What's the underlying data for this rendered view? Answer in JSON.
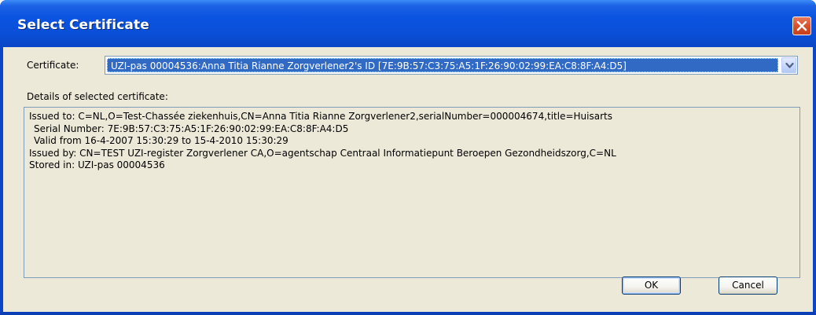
{
  "window": {
    "title": "Select Certificate"
  },
  "certificate": {
    "label": "Certificate:",
    "selected": "UZI-pas 00004536:Anna Titia Rianne Zorgverlener2's ID [7E:9B:57:C3:75:A5:1F:26:90:02:99:EA:C8:8F:A4:D5]"
  },
  "details": {
    "label": "Details of selected certificate:",
    "lines": [
      "Issued to: C=NL,O=Test-Chassée ziekenhuis,CN=Anna Titia Rianne Zorgverlener2,serialNumber=000004674,title=Huisarts",
      "Serial Number: 7E:9B:57:C3:75:A5:1F:26:90:02:99:EA:C8:8F:A4:D5",
      "Valid from 16-4-2007 15:30:29 to 15-4-2010 15:30:29",
      "Issued by: CN=TEST UZI-register Zorgverlener CA,O=agentschap Centraal Informatiepunt Beroepen Gezondheidszorg,C=NL",
      "Stored in: UZI-pas 00004536"
    ]
  },
  "buttons": {
    "ok": "OK",
    "cancel": "Cancel"
  },
  "icons": {
    "close": "close-icon",
    "dropdown": "chevron-down-icon"
  },
  "colors": {
    "titlebar": "#0a4fd8",
    "selection": "#316ac5",
    "close_button": "#d9512c",
    "dialog_background": "#ece9d8"
  }
}
